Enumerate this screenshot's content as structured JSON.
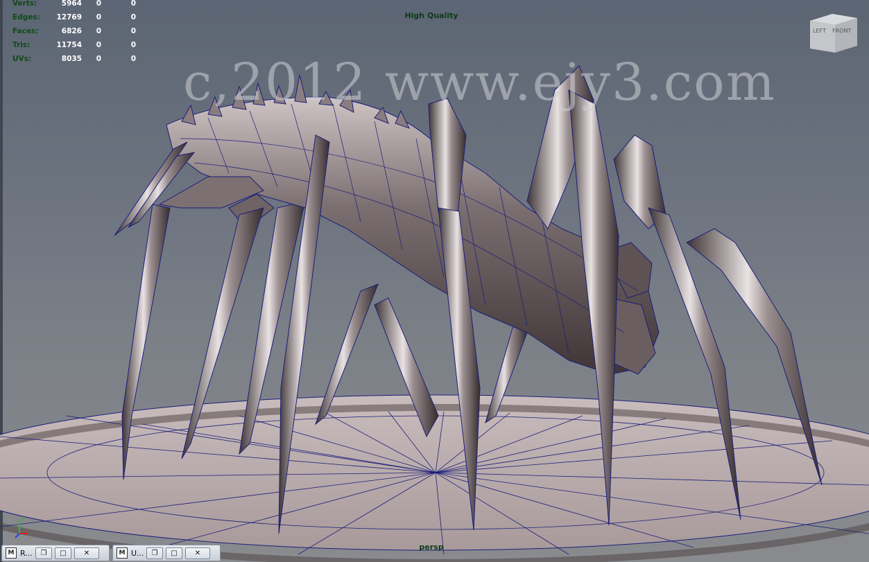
{
  "hud": {
    "rows": [
      {
        "label": "Verts:",
        "a": "5964",
        "b": "0",
        "c": "0"
      },
      {
        "label": "Edges:",
        "a": "12769",
        "b": "0",
        "c": "0"
      },
      {
        "label": "Faces:",
        "a": "6826",
        "b": "0",
        "c": "0"
      },
      {
        "label": "Tris:",
        "a": "11754",
        "b": "0",
        "c": "0"
      },
      {
        "label": "UVs:",
        "a": "8035",
        "b": "0",
        "c": "0"
      }
    ]
  },
  "viewport": {
    "quality_label": "High Quality",
    "camera_label": "persp",
    "watermark": "c,2012 www.ejy3.com",
    "viewcube": {
      "left": "LEFT",
      "front": "FRONT"
    },
    "axis": {
      "y": "y",
      "z": "z"
    }
  },
  "taskbar": [
    {
      "icon": "maya-window-icon",
      "title": "R..."
    },
    {
      "icon": "maya-window-icon",
      "title": "U..."
    }
  ],
  "colors": {
    "hud_label": "#0f4a18",
    "wireframe": "#1b1e7a",
    "model": "#6b5f60"
  }
}
